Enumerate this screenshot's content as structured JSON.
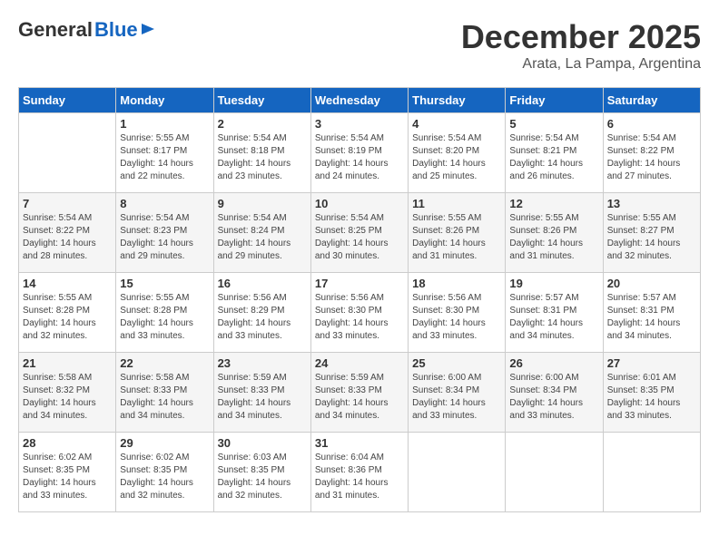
{
  "logo": {
    "general": "General",
    "blue": "Blue"
  },
  "header": {
    "month": "December 2025",
    "location": "Arata, La Pampa, Argentina"
  },
  "weekdays": [
    "Sunday",
    "Monday",
    "Tuesday",
    "Wednesday",
    "Thursday",
    "Friday",
    "Saturday"
  ],
  "weeks": [
    [
      {
        "day": "",
        "sunrise": "",
        "sunset": "",
        "daylight": ""
      },
      {
        "day": "1",
        "sunrise": "Sunrise: 5:55 AM",
        "sunset": "Sunset: 8:17 PM",
        "daylight": "Daylight: 14 hours and 22 minutes."
      },
      {
        "day": "2",
        "sunrise": "Sunrise: 5:54 AM",
        "sunset": "Sunset: 8:18 PM",
        "daylight": "Daylight: 14 hours and 23 minutes."
      },
      {
        "day": "3",
        "sunrise": "Sunrise: 5:54 AM",
        "sunset": "Sunset: 8:19 PM",
        "daylight": "Daylight: 14 hours and 24 minutes."
      },
      {
        "day": "4",
        "sunrise": "Sunrise: 5:54 AM",
        "sunset": "Sunset: 8:20 PM",
        "daylight": "Daylight: 14 hours and 25 minutes."
      },
      {
        "day": "5",
        "sunrise": "Sunrise: 5:54 AM",
        "sunset": "Sunset: 8:21 PM",
        "daylight": "Daylight: 14 hours and 26 minutes."
      },
      {
        "day": "6",
        "sunrise": "Sunrise: 5:54 AM",
        "sunset": "Sunset: 8:22 PM",
        "daylight": "Daylight: 14 hours and 27 minutes."
      }
    ],
    [
      {
        "day": "7",
        "sunrise": "Sunrise: 5:54 AM",
        "sunset": "Sunset: 8:22 PM",
        "daylight": "Daylight: 14 hours and 28 minutes."
      },
      {
        "day": "8",
        "sunrise": "Sunrise: 5:54 AM",
        "sunset": "Sunset: 8:23 PM",
        "daylight": "Daylight: 14 hours and 29 minutes."
      },
      {
        "day": "9",
        "sunrise": "Sunrise: 5:54 AM",
        "sunset": "Sunset: 8:24 PM",
        "daylight": "Daylight: 14 hours and 29 minutes."
      },
      {
        "day": "10",
        "sunrise": "Sunrise: 5:54 AM",
        "sunset": "Sunset: 8:25 PM",
        "daylight": "Daylight: 14 hours and 30 minutes."
      },
      {
        "day": "11",
        "sunrise": "Sunrise: 5:55 AM",
        "sunset": "Sunset: 8:26 PM",
        "daylight": "Daylight: 14 hours and 31 minutes."
      },
      {
        "day": "12",
        "sunrise": "Sunrise: 5:55 AM",
        "sunset": "Sunset: 8:26 PM",
        "daylight": "Daylight: 14 hours and 31 minutes."
      },
      {
        "day": "13",
        "sunrise": "Sunrise: 5:55 AM",
        "sunset": "Sunset: 8:27 PM",
        "daylight": "Daylight: 14 hours and 32 minutes."
      }
    ],
    [
      {
        "day": "14",
        "sunrise": "Sunrise: 5:55 AM",
        "sunset": "Sunset: 8:28 PM",
        "daylight": "Daylight: 14 hours and 32 minutes."
      },
      {
        "day": "15",
        "sunrise": "Sunrise: 5:55 AM",
        "sunset": "Sunset: 8:28 PM",
        "daylight": "Daylight: 14 hours and 33 minutes."
      },
      {
        "day": "16",
        "sunrise": "Sunrise: 5:56 AM",
        "sunset": "Sunset: 8:29 PM",
        "daylight": "Daylight: 14 hours and 33 minutes."
      },
      {
        "day": "17",
        "sunrise": "Sunrise: 5:56 AM",
        "sunset": "Sunset: 8:30 PM",
        "daylight": "Daylight: 14 hours and 33 minutes."
      },
      {
        "day": "18",
        "sunrise": "Sunrise: 5:56 AM",
        "sunset": "Sunset: 8:30 PM",
        "daylight": "Daylight: 14 hours and 33 minutes."
      },
      {
        "day": "19",
        "sunrise": "Sunrise: 5:57 AM",
        "sunset": "Sunset: 8:31 PM",
        "daylight": "Daylight: 14 hours and 34 minutes."
      },
      {
        "day": "20",
        "sunrise": "Sunrise: 5:57 AM",
        "sunset": "Sunset: 8:31 PM",
        "daylight": "Daylight: 14 hours and 34 minutes."
      }
    ],
    [
      {
        "day": "21",
        "sunrise": "Sunrise: 5:58 AM",
        "sunset": "Sunset: 8:32 PM",
        "daylight": "Daylight: 14 hours and 34 minutes."
      },
      {
        "day": "22",
        "sunrise": "Sunrise: 5:58 AM",
        "sunset": "Sunset: 8:33 PM",
        "daylight": "Daylight: 14 hours and 34 minutes."
      },
      {
        "day": "23",
        "sunrise": "Sunrise: 5:59 AM",
        "sunset": "Sunset: 8:33 PM",
        "daylight": "Daylight: 14 hours and 34 minutes."
      },
      {
        "day": "24",
        "sunrise": "Sunrise: 5:59 AM",
        "sunset": "Sunset: 8:33 PM",
        "daylight": "Daylight: 14 hours and 34 minutes."
      },
      {
        "day": "25",
        "sunrise": "Sunrise: 6:00 AM",
        "sunset": "Sunset: 8:34 PM",
        "daylight": "Daylight: 14 hours and 33 minutes."
      },
      {
        "day": "26",
        "sunrise": "Sunrise: 6:00 AM",
        "sunset": "Sunset: 8:34 PM",
        "daylight": "Daylight: 14 hours and 33 minutes."
      },
      {
        "day": "27",
        "sunrise": "Sunrise: 6:01 AM",
        "sunset": "Sunset: 8:35 PM",
        "daylight": "Daylight: 14 hours and 33 minutes."
      }
    ],
    [
      {
        "day": "28",
        "sunrise": "Sunrise: 6:02 AM",
        "sunset": "Sunset: 8:35 PM",
        "daylight": "Daylight: 14 hours and 33 minutes."
      },
      {
        "day": "29",
        "sunrise": "Sunrise: 6:02 AM",
        "sunset": "Sunset: 8:35 PM",
        "daylight": "Daylight: 14 hours and 32 minutes."
      },
      {
        "day": "30",
        "sunrise": "Sunrise: 6:03 AM",
        "sunset": "Sunset: 8:35 PM",
        "daylight": "Daylight: 14 hours and 32 minutes."
      },
      {
        "day": "31",
        "sunrise": "Sunrise: 6:04 AM",
        "sunset": "Sunset: 8:36 PM",
        "daylight": "Daylight: 14 hours and 31 minutes."
      },
      {
        "day": "",
        "sunrise": "",
        "sunset": "",
        "daylight": ""
      },
      {
        "day": "",
        "sunrise": "",
        "sunset": "",
        "daylight": ""
      },
      {
        "day": "",
        "sunrise": "",
        "sunset": "",
        "daylight": ""
      }
    ]
  ]
}
